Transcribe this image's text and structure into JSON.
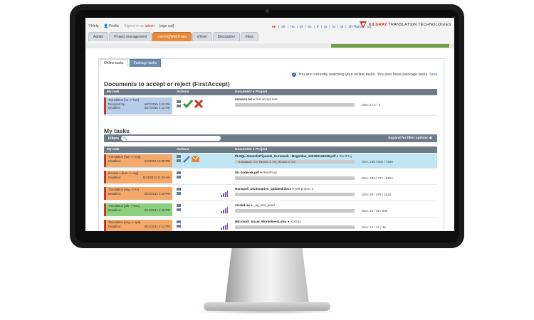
{
  "toplinks": {
    "help": "Help",
    "profile": "Profile",
    "signed_in": "Signed in as",
    "user": "admin",
    "sign_out": "[sign out]"
  },
  "languages": [
    "en",
    "de",
    "hu",
    "pt",
    "es",
    "fr",
    "ja",
    "ru",
    "pl",
    "zh-Hans",
    "sq"
  ],
  "active_language": "en",
  "logo": {
    "brand": "KILGRAY",
    "rest": " TRANSLATION TECHNOLOGIES"
  },
  "nav_tabs": [
    "Admin",
    "Project management",
    "memoQWebTrans",
    "qTerm",
    "Discussion",
    "Files"
  ],
  "active_nav": "memoQWebTrans",
  "green_bar_label": "",
  "panel_tabs": [
    "Online tasks",
    "Package tasks"
  ],
  "active_panel_tab": "Package tasks",
  "info": {
    "text": "You are currently watching your online tasks. You also have package tasks",
    "link": "here."
  },
  "section1": {
    "title": "Documents to accept or reject (FirstAccept)",
    "headers": {
      "task": "My task",
      "actions": "Actions",
      "doc": "Document ● Project"
    },
    "row": {
      "type": "Translation [hu -> hun]",
      "label1": "Respond by:",
      "date1": "5/27/2015 4:42 PM",
      "label2": "Deadline:",
      "date2": "5/27/2015 4:42 PM",
      "file": "narancs.txt",
      "project": "first accept test",
      "size": "Size: 1 / 1 / 4",
      "color": "#b8cdea"
    }
  },
  "section2": {
    "title": "My tasks",
    "filter_label": "Filters",
    "filter_placeholder": "Search",
    "expand_label": "Expand for filter options",
    "headers": {
      "task": "My task",
      "actions": "Actions",
      "doc": "Document ● Project"
    },
    "rows": [
      {
        "type": "Translation [hun -> eng]",
        "label": "Deadline:",
        "date": "5/3/2014 12:50 PM",
        "file": "PLSQL-OsszefoITipusok_Kurzonok - Megoldas_120306134239.pdf",
        "project": "ReniProj",
        "progress": "Translation: 1%, Review 1: 0%, Review 2: 0%",
        "size": "Size: 236 / 800 / 7469",
        "color": "#f4a86a",
        "highlight": true
      },
      {
        "type": "Review 1 [hun -> eng]",
        "label": "Deadline:",
        "date": "5/24/2014 11:46 AM",
        "file": "05 - Indexek.pdf",
        "project": "ReniProj2",
        "progress": "",
        "size": "Size: 189 / 727 / 6254",
        "color": "#f4a86a",
        "highlight": false
      },
      {
        "type": "Translation [eng -> fre]",
        "label": "Deadline:",
        "date": "5/24/2014 4:29 PM",
        "file": "Hunspell_Dictionaries_updated.docx",
        "project": "test project 1",
        "progress": "",
        "size": "Size: 58 / 476 / 4233",
        "color": "#f4a86a",
        "highlight": false
      },
      {
        "type": "Translation [alb -> bos]",
        "label": "Deadline:",
        "date": "5/14/2014 2:46 PM",
        "file": "clockd.ini",
        "project": "_ug_test_dead",
        "progress": "",
        "size": "Size: 18 / 26 / 339",
        "color": "#8ccf7e",
        "highlight": false
      },
      {
        "type": "Translation [eng -> spa]",
        "label": "Deadline:",
        "date": "5/21/2014 4:12 PM",
        "file": "Microsoft_Excel_Worksheet1.xlsx",
        "project": "e15234",
        "progress": "",
        "size": "Size: 17 / 17 / 46",
        "color": "#f4a86a",
        "highlight": false
      }
    ]
  },
  "colors": {
    "accent": "#e8893a",
    "header": "#6e7b89",
    "link": "#3a67b0",
    "reject": "#c0392b",
    "accept": "#2e9b3a"
  }
}
